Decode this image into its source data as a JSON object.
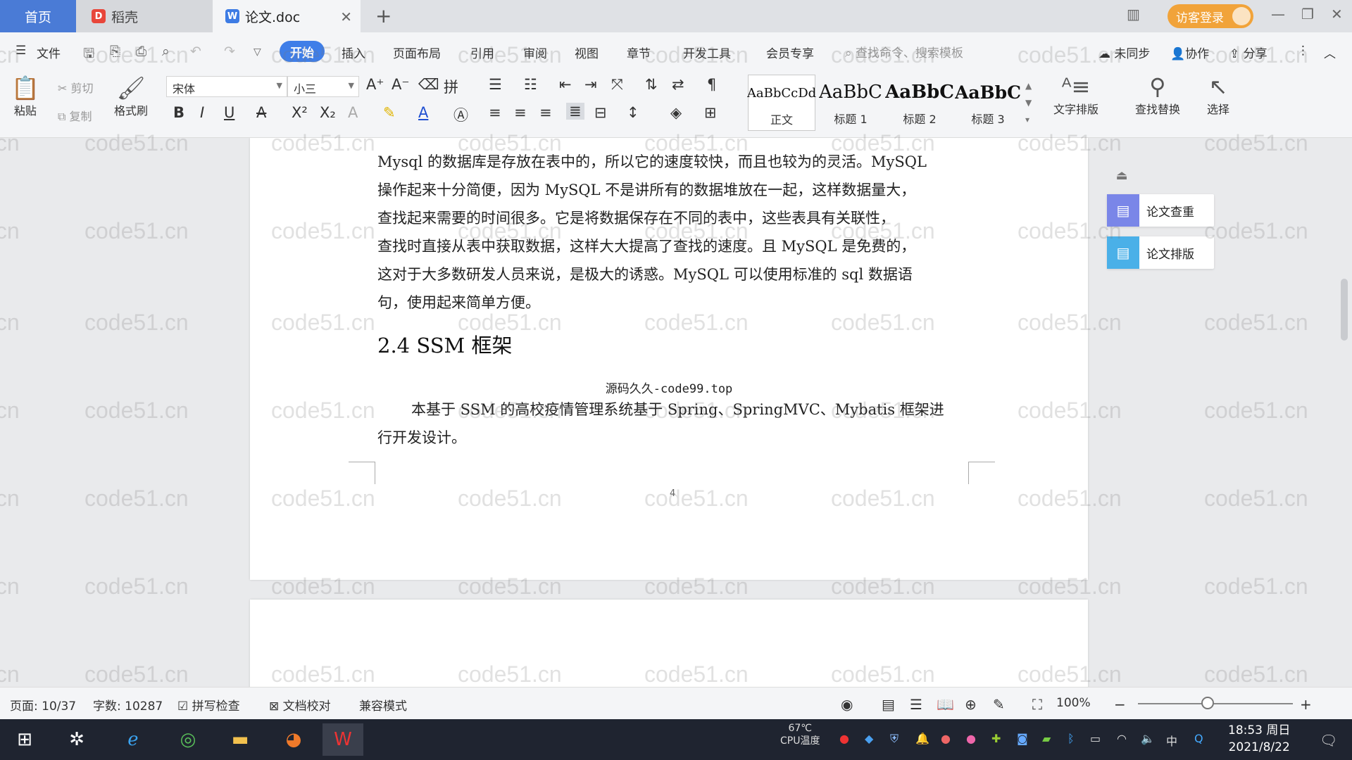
{
  "tabs": {
    "home": "首页",
    "daoke": "稻壳",
    "doc": "论文.doc"
  },
  "header": {
    "login_label": "访客登录"
  },
  "menu": {
    "file": "文件",
    "items": [
      "开始",
      "插入",
      "页面布局",
      "引用",
      "审阅",
      "视图",
      "章节",
      "开发工具",
      "会员专享"
    ],
    "search_placeholder": "查找命令、搜索模板",
    "sync": "未同步",
    "collab": "协作",
    "share": "分享"
  },
  "ribbon": {
    "paste": "粘贴",
    "cut": "剪切",
    "copy": "复制",
    "format_painter": "格式刷",
    "font_name": "宋体",
    "font_size": "小三",
    "styles": [
      {
        "sample": "AaBbCcDd",
        "label": "正文"
      },
      {
        "sample": "AaBbC",
        "label": "标题 1"
      },
      {
        "sample": "AaBbC",
        "label": "标题 2"
      },
      {
        "sample": "AaBbC",
        "label": "标题 3"
      }
    ],
    "text_layout": "文字排版",
    "find_replace": "查找替换",
    "select": "选择"
  },
  "document": {
    "paragraph1_lines": [
      "Mysql 的数据库是存放在表中的，所以它的速度较快，而且也较为的灵活。MySQL",
      "操作起来十分简便，因为 MySQL 不是讲所有的数据堆放在一起，这样数据量大，",
      "查找起来需要的时间很多。它是将数据保存在不同的表中，这些表具有关联性，",
      "查找时直接从表中获取数据，这样大大提高了查找的速度。且 MySQL 是免费的，",
      "这对于大多数研发人员来说，是极大的诱惑。MySQL 可以使用标准的 sql 数据语",
      "句，使用起来简单方便。"
    ],
    "heading": "2.4 SSM 框架",
    "source_note": "源码久久-code99.top",
    "paragraph2_lines": [
      "本基于 SSM 的高校疫情管理系统基于 Spring、SpringMVC、Mybatis 框架进",
      "行开发设计。"
    ],
    "page_number": "4"
  },
  "side_panel": {
    "check": "论文查重",
    "format": "论文排版"
  },
  "watermark_text": "code51.cn",
  "statusbar": {
    "page": "页面: 10/37",
    "words": "字数: 10287",
    "spell": "拼写检查",
    "proof": "文档校对",
    "compat": "兼容模式",
    "zoom": "100%"
  },
  "taskbar": {
    "cpu_temp": "67℃",
    "cpu_label": "CPU温度",
    "ime": "中",
    "time": "18:53 周日",
    "date": "2021/8/22"
  },
  "colors": {
    "accent": "#3f7ee8",
    "home_tab": "#4a7bd6",
    "login": "#f1a33a"
  }
}
